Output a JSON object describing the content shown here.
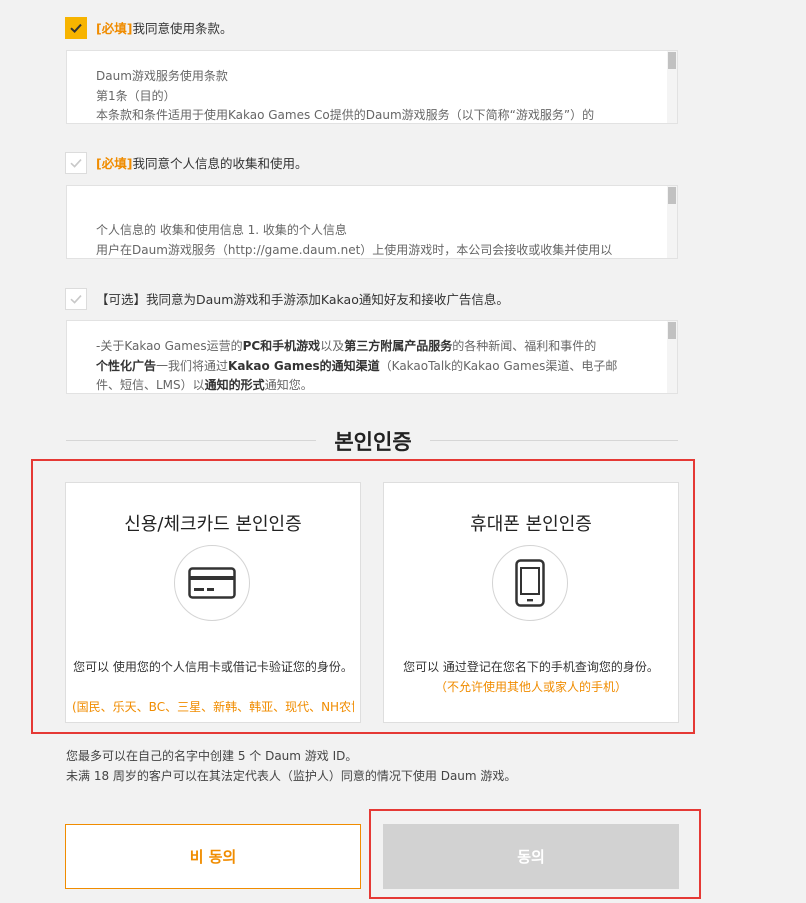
{
  "consents": [
    {
      "tag": "[必填]",
      "label": "我同意使用条款。",
      "checked": true,
      "lines": [
        "Daum游戏服务使用条款",
        "第1条（目的）",
        "本条款和条件适用于使用Kakao Games Co提供的Daum游戏服务（以下简称“游戏服务”）的"
      ]
    },
    {
      "tag": "[必填]",
      "label": "我同意个人信息的收集和使用。",
      "checked": false,
      "lines": [
        "个人信息的 收集和使用信息 1. 收集的个人信息",
        "用户在Daum游戏服务（http://game.daum.net）上使用游戏时，本公司会接收或收集并使用以"
      ]
    },
    {
      "label": "【可选】我同意为Daum游戏和手游添加Kakao通知好友和接收广告信息。",
      "checked": false,
      "ad_text": {
        "p1": "-关于Kakao Games运营的",
        "b1": "PC和手机游戏",
        "p2": "以及",
        "b2": "第三方附属产品服务",
        "p3": "的各种新闻、福利和事件的",
        "b3": "个性化广告",
        "p4": "一我们将通过",
        "b4": "Kakao Games的通知渠道",
        "p5": "（KakaoTalk的Kakao Games渠道、电子邮",
        "p6": "件、短信、LMS）以",
        "b5": "通知的形式",
        "p7": "通知您。"
      }
    }
  ],
  "section_title": "본인인증",
  "auth_cards": [
    {
      "title": "신용/체크카드 본인인증",
      "icon": "credit-card-icon",
      "desc": "您可以 使用您的个人信用卡或借记卡验证您的身份。",
      "note": "(国民、乐天、BC、三星、新韩、韩亚、现代、NH农协)"
    },
    {
      "title": "휴대폰 본인인증",
      "icon": "mobile-phone-icon",
      "desc": "您可以 通过登记在您名下的手机查询您的身份。",
      "note": "（不允许使用其他人或家人的手机）"
    }
  ],
  "info": [
    "您最多可以在自己的名字中创建 5 个 Daum 游戏 ID。",
    "未满 18 周岁的客户可以在其法定代表人（监护人）同意的情况下使用 Daum 游戏。"
  ],
  "buttons": {
    "disagree": "비 동의",
    "agree": "동의"
  },
  "colors": {
    "accent": "#f08c00",
    "checkbox_on": "#f7b400",
    "highlight": "#e53935",
    "agree_disabled": "#d2d2d2"
  }
}
